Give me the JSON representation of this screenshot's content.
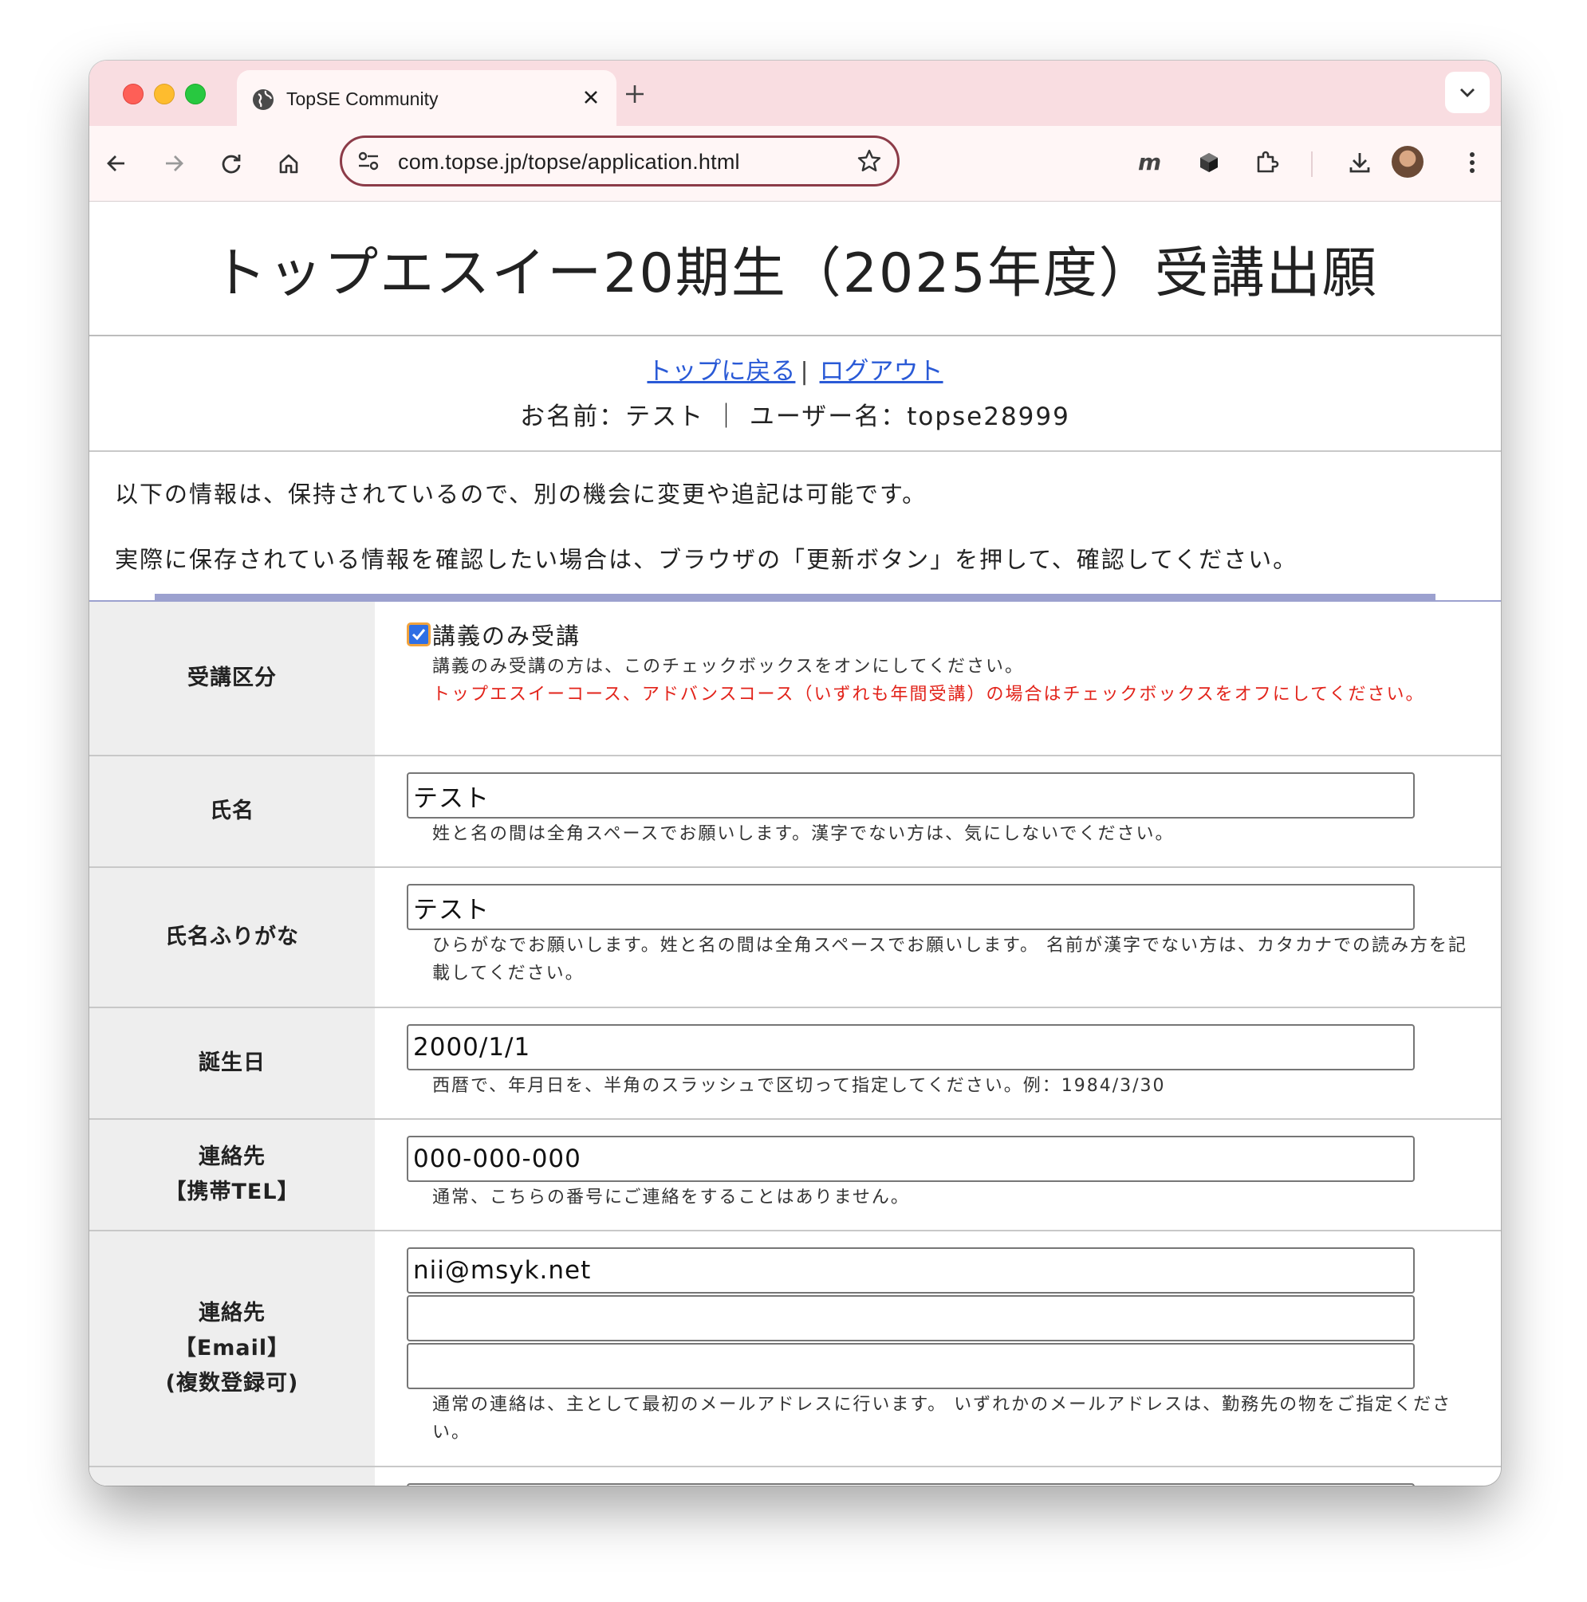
{
  "browser": {
    "tab_title": "TopSE Community",
    "url": "com.topse.jp/topse/application.html",
    "toolbar_icons": [
      "back-icon",
      "forward-icon",
      "reload-icon",
      "home-icon",
      "site-settings-icon",
      "bookmark-star-icon",
      "m-extension-icon",
      "cube-extension-icon",
      "extensions-puzzle-icon",
      "download-icon",
      "profile-avatar",
      "more-menu-icon"
    ]
  },
  "page": {
    "title": "トップエスイー20期生（2025年度）受講出願",
    "links": {
      "top": "トップに戻る",
      "separator": "|",
      "logout": "ログアウト"
    },
    "user_info": "お名前：テスト ｜ ユーザー名：topse28999",
    "intro": [
      "以下の情報は、保持されているので、別の機会に変更や追記は可能です。",
      "実際に保存されている情報を確認したい場合は、ブラウザの「更新ボタン」を押して、確認してください。"
    ]
  },
  "form": {
    "course_type": {
      "label": "受講区分",
      "checkbox_label": "講義のみ受講",
      "checked": true,
      "note": "講義のみ受講の方は、このチェックボックスをオンにしてください。",
      "warning": "トップエスイーコース、アドバンスコース（いずれも年間受講）の場合はチェックボックスをオフにしてください。"
    },
    "name": {
      "label": "氏名",
      "value": "テスト",
      "note": "姓と名の間は全角スペースでお願いします。漢字でない方は、気にしないでください。"
    },
    "furigana": {
      "label": "氏名ふりがな",
      "value": "テスト",
      "note": "ひらがなでお願いします。姓と名の間は全角スペースでお願いします。 名前が漢字でない方は、カタカナでの読み方を記載してください。"
    },
    "birthday": {
      "label": "誕生日",
      "value": "2000/1/1",
      "note": "西暦で、年月日を、半角のスラッシュで区切って指定してください。例：1984/3/30"
    },
    "phone": {
      "label_line1": "連絡先",
      "label_line2": "【携帯TEL】",
      "value": "000-000-000",
      "note": "通常、こちらの番号にご連絡をすることはありません。"
    },
    "email": {
      "label_line1": "連絡先",
      "label_line2": "【Email】",
      "label_line3": "(複数登録可)",
      "value1": "nii@msyk.net",
      "value2": "",
      "value3": "",
      "note": "通常の連絡は、主として最初のメールアドレスに行います。 いずれかのメールアドレスは、勤務先の物をご指定ください。"
    }
  }
}
